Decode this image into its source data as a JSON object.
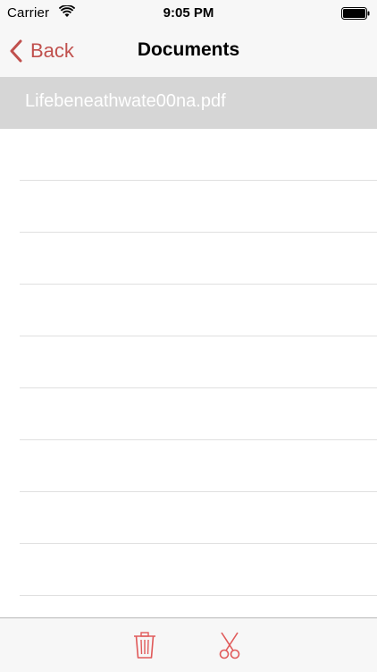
{
  "status_bar": {
    "carrier": "Carrier",
    "time": "9:05 PM"
  },
  "nav": {
    "back_label": "Back",
    "title": "Documents"
  },
  "documents": [
    {
      "name": "Lifebeneathwate00na.pdf",
      "selected": true
    },
    {
      "name": ""
    },
    {
      "name": ""
    },
    {
      "name": ""
    },
    {
      "name": ""
    },
    {
      "name": ""
    },
    {
      "name": ""
    },
    {
      "name": ""
    },
    {
      "name": ""
    },
    {
      "name": ""
    },
    {
      "name": ""
    }
  ],
  "toolbar": {
    "trash_icon": "trash-icon",
    "cut_icon": "scissors-icon"
  },
  "colors": {
    "accent": "#c0504d",
    "selected_row": "#d6d6d6",
    "bar_background": "#f7f7f7"
  }
}
